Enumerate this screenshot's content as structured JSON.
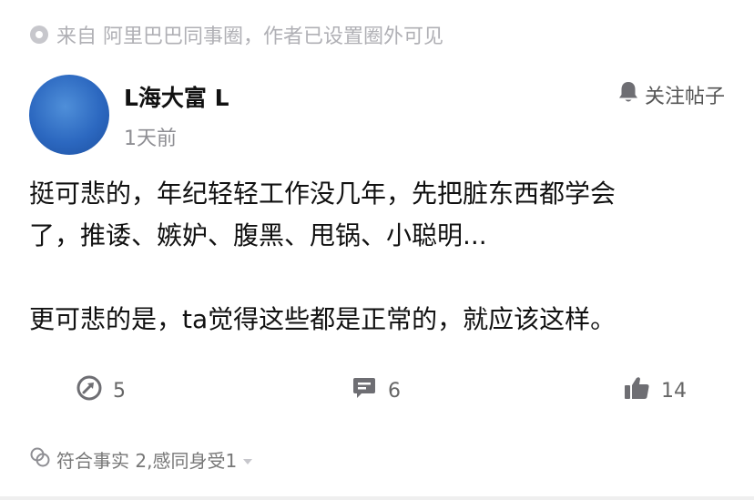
{
  "source": {
    "text": "来自 阿里巴巴同事圈，作者已设置圈外可见",
    "icon": "visibility-dot-icon"
  },
  "author": {
    "name": "L海大富 L",
    "time": "1天前",
    "avatar_icon": "blue-avatar"
  },
  "follow": {
    "label": "关注帖子",
    "icon": "bell-icon"
  },
  "content": {
    "line1": "挺可悲的，年纪轻轻工作没几年，先把脏东西都学会",
    "line2": "了，推诿、嫉妒、腹黑、甩锅、小聪明...",
    "line3": "更可悲的是，ta觉得这些都是正常的，就应该这样。"
  },
  "actions": {
    "share": {
      "count": "5",
      "icon": "share-arrow-icon"
    },
    "comment": {
      "count": "6",
      "icon": "comment-bubble-icon"
    },
    "like": {
      "count": "14",
      "icon": "thumbs-up-icon"
    }
  },
  "reactions": {
    "text": "符合事实 2,感同身受1",
    "icon": "reaction-icon",
    "expand_icon": "triangle-down-icon"
  },
  "colors": {
    "meta_gray": "#b0b0b5",
    "text": "#111111",
    "icon_gray": "#6e6e73"
  }
}
